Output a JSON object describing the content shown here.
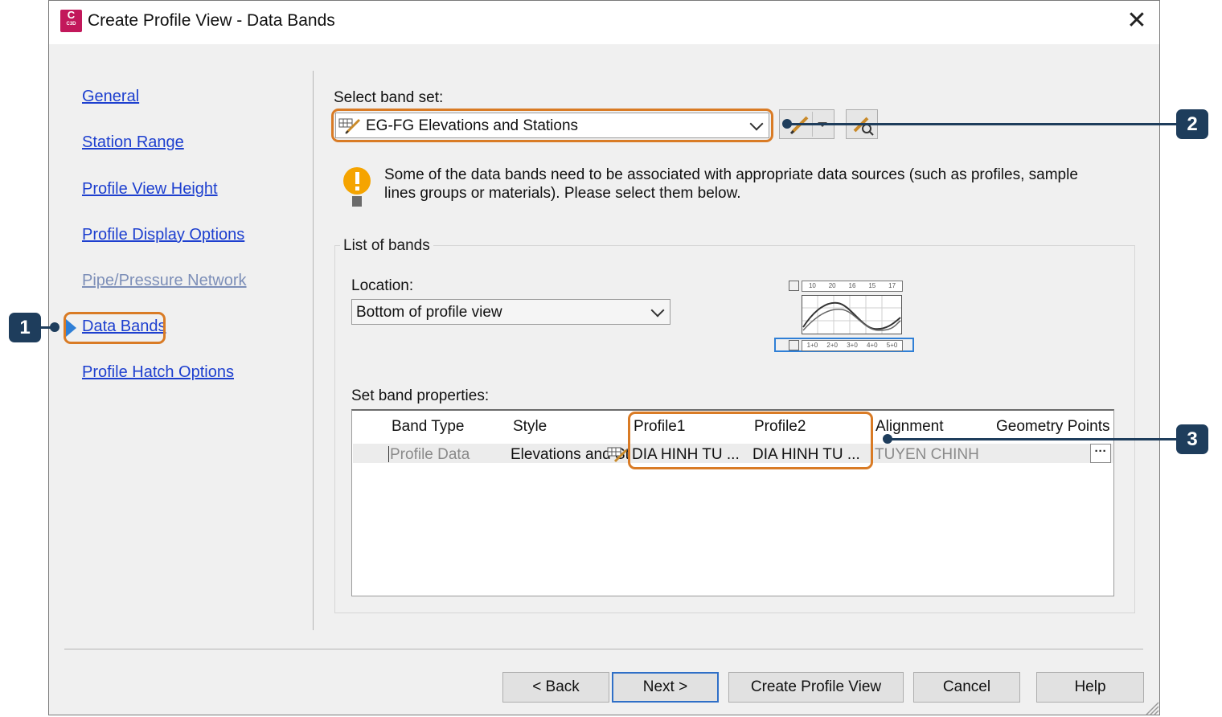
{
  "window": {
    "title": "Create Profile View - Data Bands",
    "app_icon_letter": "C",
    "app_icon_sub": "C3D",
    "close_glyph": "✕"
  },
  "nav": {
    "items": [
      {
        "label": "General",
        "enabled": true
      },
      {
        "label": "Station Range",
        "enabled": true
      },
      {
        "label": "Profile View Height",
        "enabled": true
      },
      {
        "label": "Profile Display Options",
        "enabled": true
      },
      {
        "label": "Pipe/Pressure Network",
        "enabled": false
      },
      {
        "label": "Data Bands",
        "enabled": true,
        "active": true
      },
      {
        "label": "Profile Hatch Options",
        "enabled": true
      }
    ]
  },
  "band_set": {
    "label": "Select band set:",
    "value": "EG-FG Elevations and Stations"
  },
  "warning": {
    "line1": "Some of the data bands need to be associated with appropriate data sources (such as profiles, sample",
    "line2": "lines groups or materials). Please select them below."
  },
  "list_of_bands": {
    "title": "List of bands",
    "location_label": "Location:",
    "location_value": "Bottom of profile view",
    "preview_top_ticks": [
      "10",
      "20",
      "16",
      "15",
      "17"
    ],
    "preview_bottom_ticks": [
      "1+0",
      "2+0",
      "3+0",
      "4+0",
      "5+0"
    ]
  },
  "band_properties": {
    "label": "Set band properties:",
    "columns": [
      "Band Type",
      "Style",
      "Profile1",
      "Profile2",
      "Alignment",
      "Geometry Points"
    ],
    "rows": [
      {
        "band_type": "Profile Data",
        "style": "Elevations and St",
        "profile1": "DIA HINH TU ...",
        "profile2": "DIA HINH TU ...",
        "alignment": "TUYEN CHINH",
        "geometry_points": "···"
      }
    ]
  },
  "buttons": {
    "back": "< Back",
    "next": "Next >",
    "create": "Create Profile View",
    "cancel": "Cancel",
    "help": "Help"
  },
  "callouts": [
    "1",
    "2",
    "3"
  ],
  "colors": {
    "link": "#1d3fcf",
    "highlight": "#d97b25",
    "callout": "#1e3d5c",
    "warning": "#f5a400"
  }
}
